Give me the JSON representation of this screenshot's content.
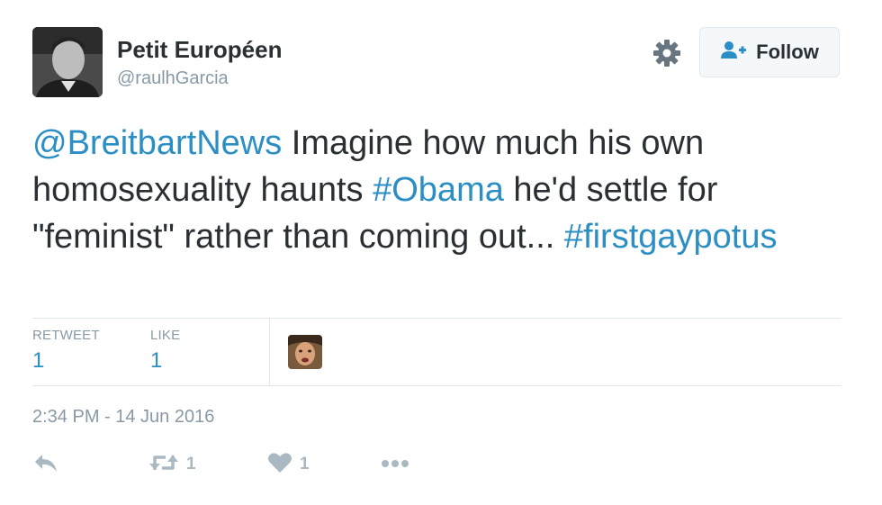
{
  "tweet": {
    "display_name": "Petit Européen",
    "handle": "@raulhGarcia",
    "text_parts": [
      {
        "text": "@BreitbartNews",
        "link": true
      },
      {
        "text": " Imagine how much his own homosexuality haunts ",
        "link": false
      },
      {
        "text": "#Obama",
        "link": true
      },
      {
        "text": " he'd settle for \"feminist\" rather than coming out... ",
        "link": false
      },
      {
        "text": "#firstgaypotus",
        "link": true
      }
    ],
    "timestamp": "2:34 PM - 14 Jun 2016"
  },
  "header": {
    "follow_label": "Follow"
  },
  "stats": {
    "retweet_label": "RETWEET",
    "retweet_count": "1",
    "like_label": "LIKE",
    "like_count": "1"
  },
  "actions": {
    "retweet_count": "1",
    "like_count": "1"
  },
  "icons": [
    "avatar",
    "gear-icon",
    "follow-person-icon",
    "liker-avatar",
    "reply-icon",
    "retweet-icon",
    "heart-icon",
    "more-icon"
  ],
  "colors": {
    "link": "#2b8ec4",
    "text": "#292f33",
    "muted": "#8899a6",
    "action_icon": "#aab8c2"
  }
}
